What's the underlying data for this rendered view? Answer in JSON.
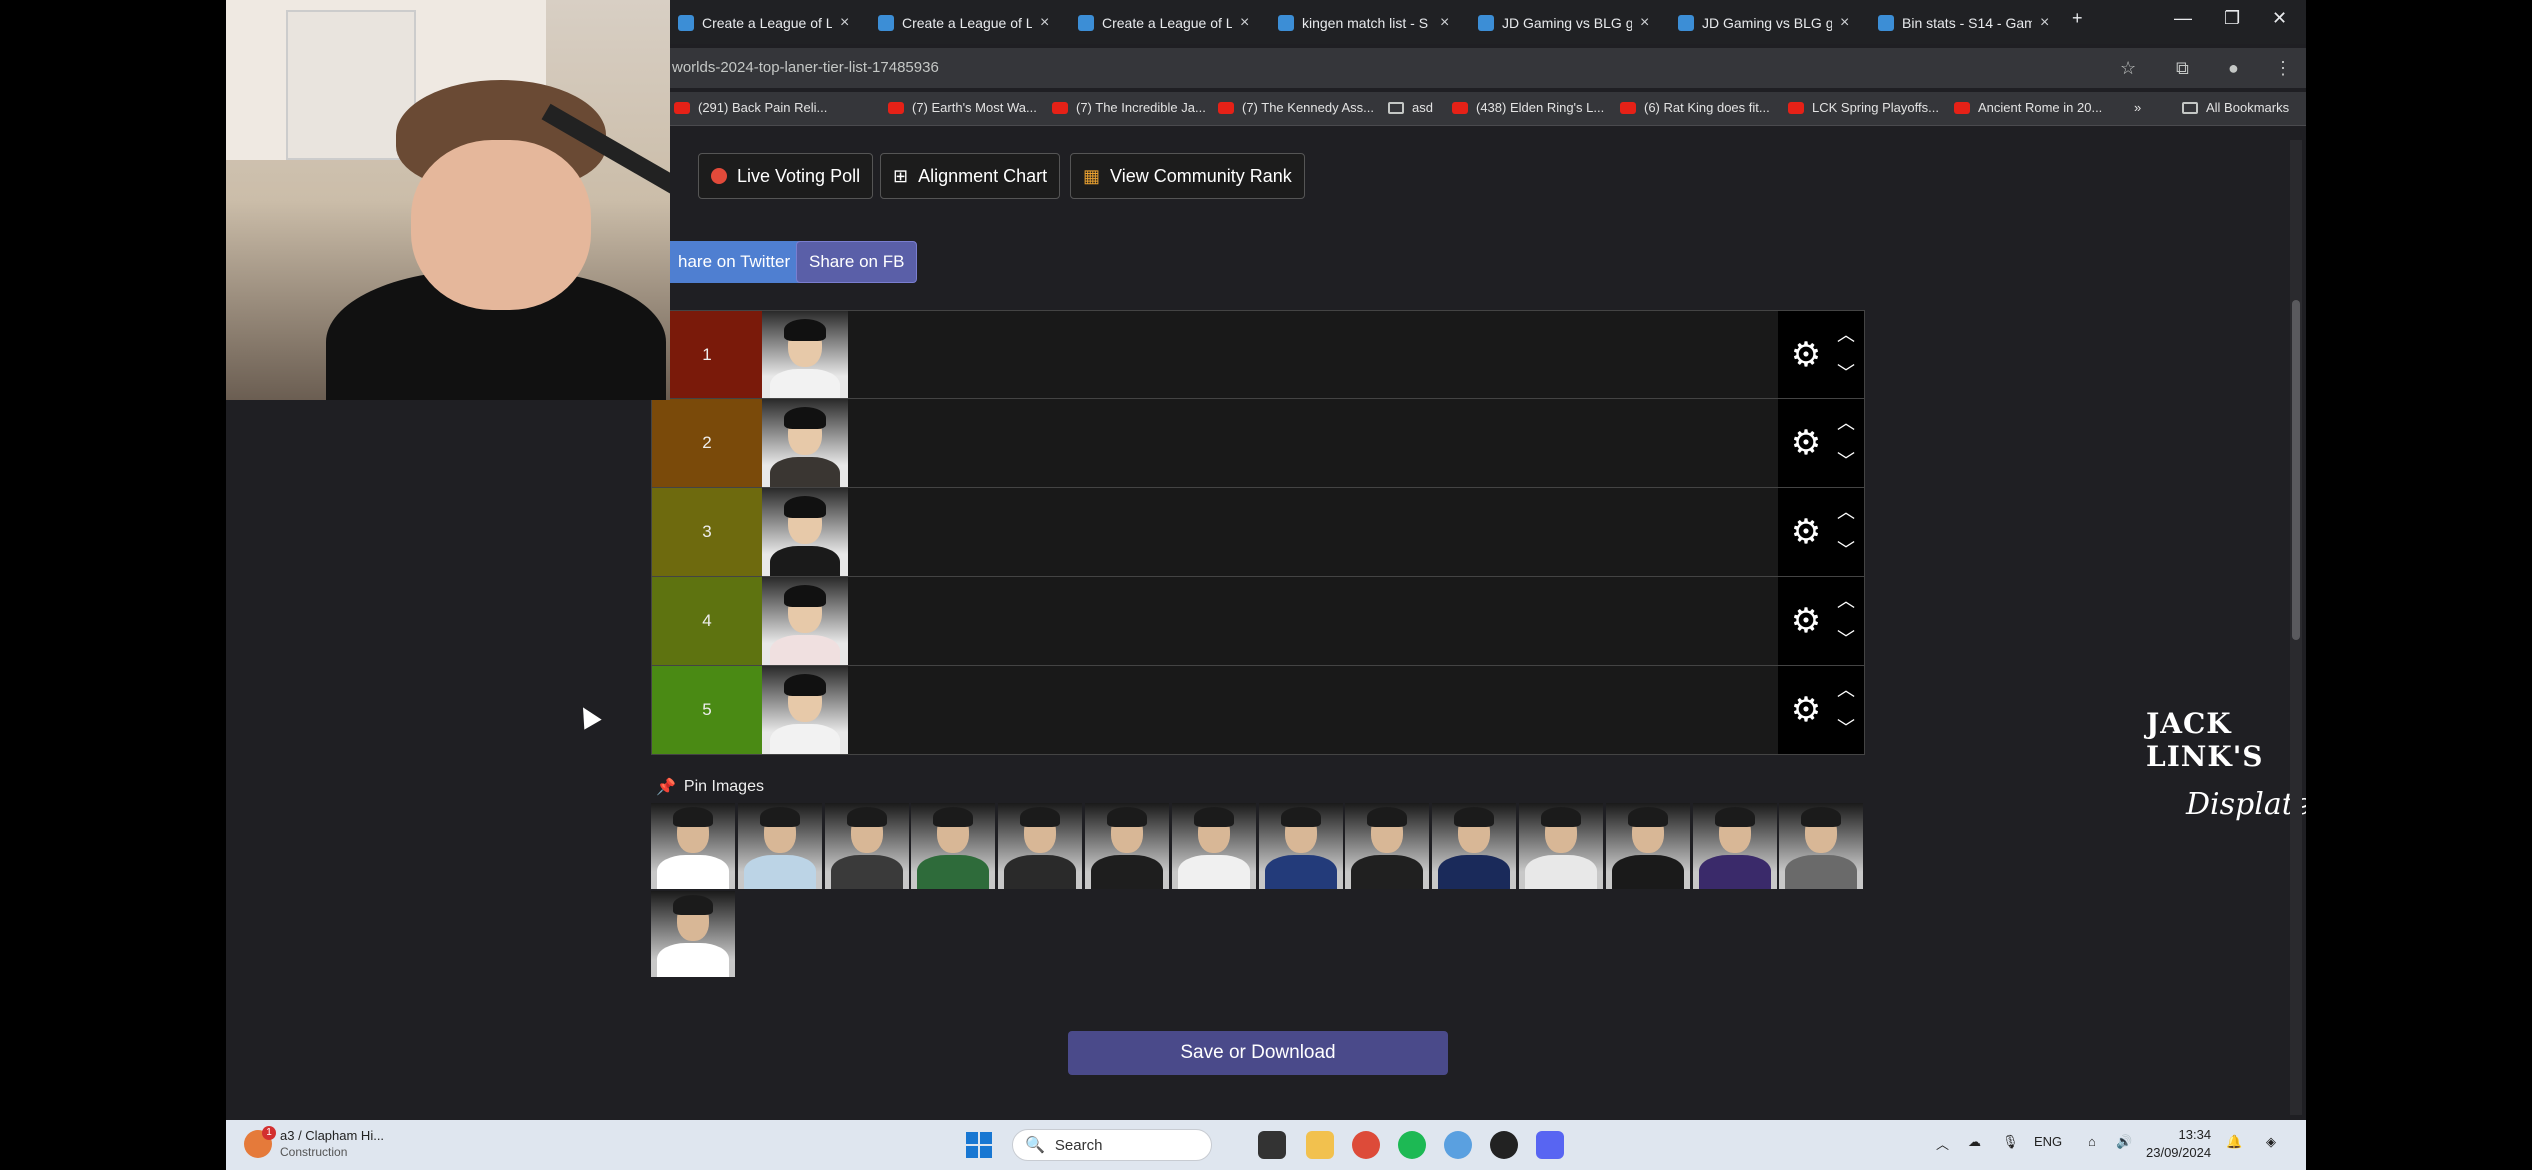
{
  "browser": {
    "tabs": [
      {
        "title": "Create a League of Le"
      },
      {
        "title": "Create a League of Le"
      },
      {
        "title": "Create a League of Le"
      },
      {
        "title": "kingen match list - S"
      },
      {
        "title": "JD Gaming vs BLG ga"
      },
      {
        "title": "JD Gaming vs BLG ga"
      },
      {
        "title": "Bin stats - S14 - Gam"
      }
    ],
    "url": "worlds-2024-top-laner-tier-list-17485936",
    "bookmarks": [
      {
        "label": "(291) Back Pain Reli..."
      },
      {
        "label": "(7) Earth's Most Wa..."
      },
      {
        "label": "(7) The Incredible Ja..."
      },
      {
        "label": "(7) The Kennedy Ass..."
      },
      {
        "label": "asd"
      },
      {
        "label": "(438) Elden Ring's L..."
      },
      {
        "label": "(6) Rat King does fit..."
      },
      {
        "label": "LCK Spring Playoffs..."
      },
      {
        "label": "Ancient Rome in 20..."
      }
    ],
    "all_bookmarks": "All Bookmarks"
  },
  "page": {
    "live_voting": "Live Voting Poll",
    "alignment_chart": "Alignment Chart",
    "community_rank": "View Community Rank",
    "share_twitter": "hare on Twitter",
    "share_fb": "Share on FB",
    "tiers": [
      {
        "label": "1",
        "color": "#7a1a0a"
      },
      {
        "label": "2",
        "color": "#7a4a0a"
      },
      {
        "label": "3",
        "color": "#6e6a0e"
      },
      {
        "label": "4",
        "color": "#5e7310"
      },
      {
        "label": "5",
        "color": "#4a8a14"
      }
    ],
    "pin_images_label": "Pin Images",
    "pin_colors": [
      "#ffffff",
      "#bcd4e6",
      "#3a3a3a",
      "#2e6b3a",
      "#2a2a2a",
      "#1e1e1e",
      "#f0f0f0",
      "#233b7a",
      "#202020",
      "#1a2a5a",
      "#e8e8e8",
      "#1a1a1a",
      "#3a2a6a",
      "#6a6a6a",
      "#ffffff"
    ],
    "save_download": "Save or Download",
    "sponsor_1": "JACK LINK'S",
    "sponsor_2": "Displate"
  },
  "taskbar": {
    "weather_title": "a3 / Clapham Hi...",
    "weather_sub": "Construction",
    "weather_badge": "1",
    "search": "Search",
    "lang": "ENG",
    "time": "13:34",
    "date": "23/09/2024"
  }
}
